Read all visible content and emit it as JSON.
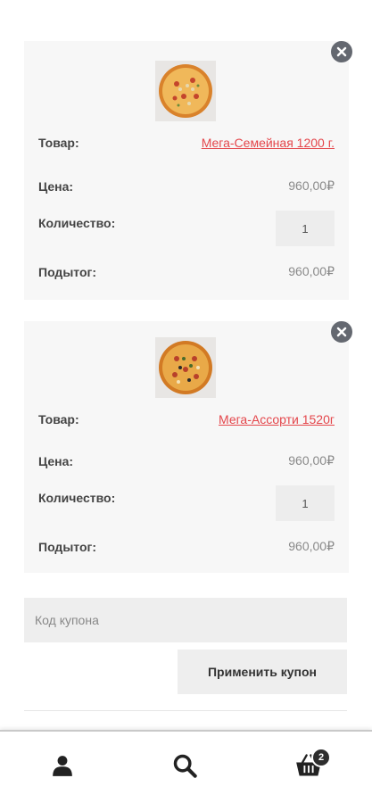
{
  "cart": {
    "items": [
      {
        "product_label": "Товар:",
        "product_name": "Мега-Семейная 1200 г.",
        "price_label": "Цена:",
        "price": "960,00₽",
        "quantity_label": "Количество:",
        "quantity": "1",
        "subtotal_label": "Подытог:",
        "subtotal": "960,00₽",
        "remove_icon": "close-icon",
        "thumbnail": "pizza-image"
      },
      {
        "product_label": "Товар:",
        "product_name": "Мега-Ассорти 1520г",
        "price_label": "Цена:",
        "price": "960,00₽",
        "quantity_label": "Количество:",
        "quantity": "1",
        "subtotal_label": "Подытог:",
        "subtotal": "960,00₽",
        "remove_icon": "close-icon",
        "thumbnail": "pizza-image"
      }
    ]
  },
  "coupon": {
    "placeholder": "Код купона",
    "apply_label": "Применить купон"
  },
  "bottom_nav": {
    "icons": [
      "user-icon",
      "search-icon",
      "cart-icon"
    ],
    "cart_count": "2"
  },
  "colors": {
    "link": "#e4464b",
    "remove": "#646870",
    "badge": "#2d2d2d"
  }
}
